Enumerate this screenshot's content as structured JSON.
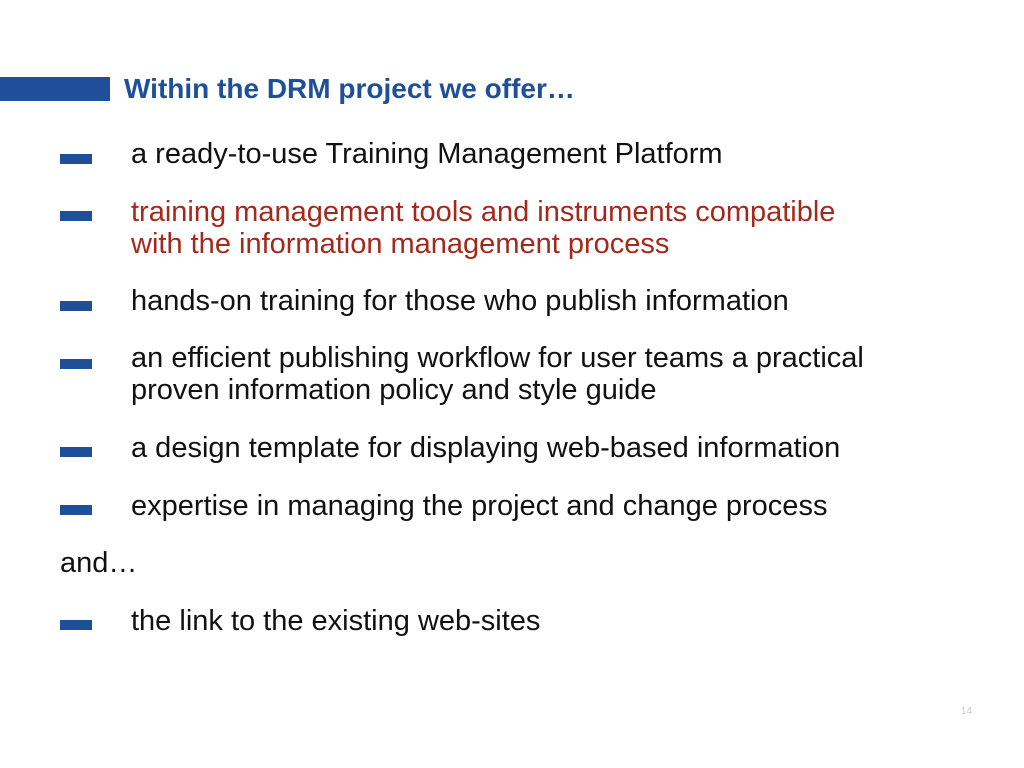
{
  "slide": {
    "title": "Within the DRM project we offer…",
    "bullets": [
      {
        "text": "a ready-to-use Training Management Platform",
        "highlight": false
      },
      {
        "text": "training management tools and instruments compatible\nwith the information management process",
        "highlight": true
      },
      {
        "text": "hands-on training for those who publish information",
        "highlight": false
      },
      {
        "text": "an efficient publishing workflow for user teams a practical\nproven information policy and style guide",
        "highlight": false
      },
      {
        "text": "a design template for displaying web-based information",
        "highlight": false
      },
      {
        "text": "expertise in managing the project and change process",
        "highlight": false
      }
    ],
    "and_text": "and…",
    "extra_bullets": [
      {
        "text": "the link to the existing web-sites",
        "highlight": false
      }
    ],
    "page_number": "14"
  },
  "colors": {
    "accent": "#1f4f99",
    "highlight_text": "#a5281b",
    "body_text": "#111111"
  }
}
